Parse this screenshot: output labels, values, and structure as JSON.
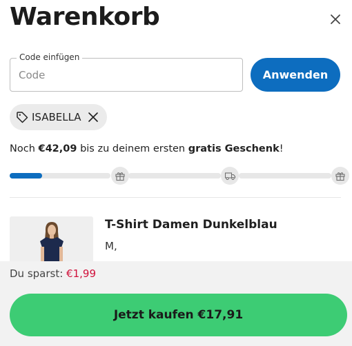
{
  "cart": {
    "title": "Warenkorb"
  },
  "coupon": {
    "legend": "Code einfügen",
    "placeholder": "Code",
    "value": "",
    "apply_label": "Anwenden",
    "applied_code": "ISABELLA"
  },
  "gift": {
    "prefix": "Noch ",
    "amount": "€42,09",
    "middle": " bis zu deinem ersten ",
    "goal": "gratis Geschenk",
    "suffix": "!",
    "progress_fraction": 0.1,
    "milestone_icons": [
      "gift-icon",
      "truck-icon",
      "gift-icon",
      "gift-icon"
    ]
  },
  "item": {
    "name": "T-Shirt Damen Dunkelblau",
    "variant": "M,"
  },
  "footer": {
    "savings_label": "Du sparst: ",
    "savings_amount": "€1,99",
    "buy_label": "Jetzt kaufen €17,91"
  },
  "colors": {
    "primary": "#0d6dbf",
    "buy": "#3dcc74",
    "savings": "#d0103a"
  }
}
